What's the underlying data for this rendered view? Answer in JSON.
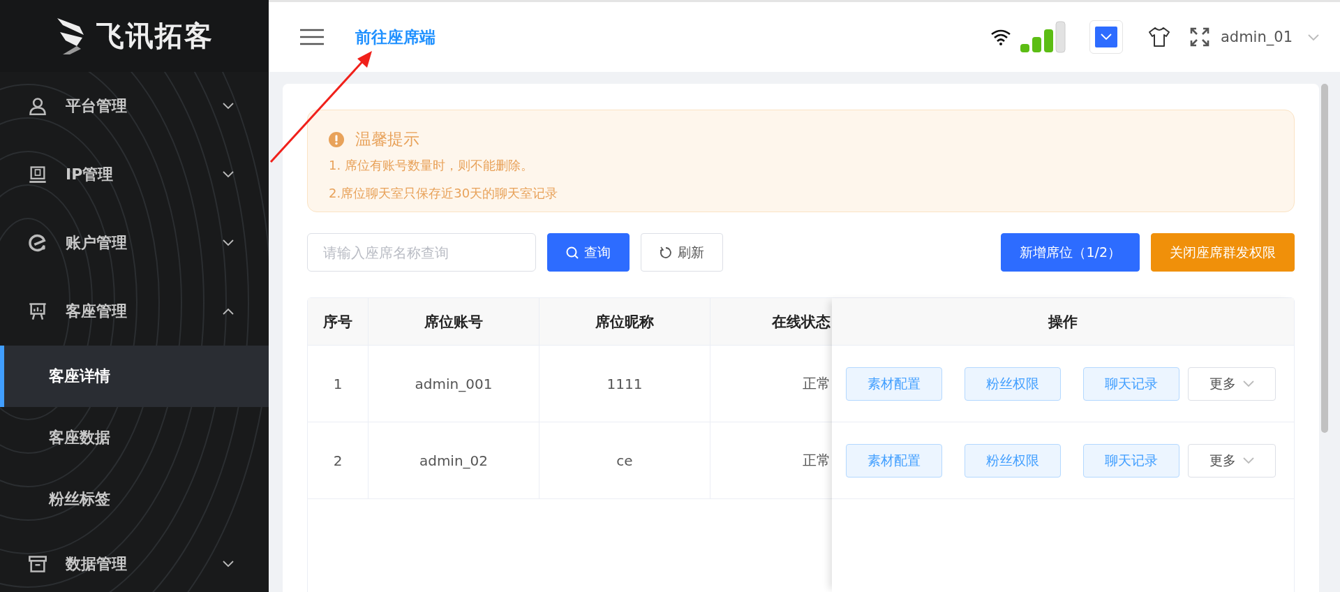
{
  "logo": {
    "text": "飞讯拓客"
  },
  "sidebar": {
    "items": [
      {
        "label": "平台管理",
        "expanded": false
      },
      {
        "label": "IP管理",
        "expanded": false
      },
      {
        "label": "账户管理",
        "expanded": false
      },
      {
        "label": "客座管理",
        "expanded": true,
        "children": [
          {
            "label": "客座详情",
            "selected": true
          },
          {
            "label": "客座数据",
            "selected": false
          },
          {
            "label": "粉丝标签",
            "selected": false
          }
        ]
      },
      {
        "label": "数据管理",
        "expanded": false
      }
    ]
  },
  "header": {
    "link": "前往座席端",
    "user": "admin_01"
  },
  "alert": {
    "title": "温馨提示",
    "lines": [
      "1. 席位有账号数量时，则不能删除。",
      "2.席位聊天室只保存近30天的聊天室记录"
    ]
  },
  "search": {
    "placeholder": "请输入座席名称查询"
  },
  "toolbar_left": [
    {
      "label": "查询",
      "kind": "primary"
    },
    {
      "label": "刷新",
      "kind": "default"
    }
  ],
  "toolbar_right": [
    {
      "label": "新增席位（1/2）",
      "kind": "primary"
    },
    {
      "label": "关闭座席群发权限",
      "kind": "warning"
    }
  ],
  "table": {
    "columns": [
      "序号",
      "席位账号",
      "席位昵称",
      "在线状态"
    ],
    "actions_column": "操作",
    "rows": [
      {
        "cells": [
          "1",
          "admin_001",
          "1111",
          "正常"
        ],
        "actions": [
          {
            "label": "素材配置",
            "kind": "plain"
          },
          {
            "label": "粉丝权限",
            "kind": "plain"
          },
          {
            "label": "聊天记录",
            "kind": "plain"
          },
          {
            "label": "更多",
            "kind": "dropdown"
          }
        ]
      },
      {
        "cells": [
          "2",
          "admin_02",
          "ce",
          "正常"
        ],
        "actions": [
          {
            "label": "素材配置",
            "kind": "plain"
          },
          {
            "label": "粉丝权限",
            "kind": "plain"
          },
          {
            "label": "聊天记录",
            "kind": "plain"
          },
          {
            "label": "更多",
            "kind": "dropdown"
          }
        ]
      }
    ]
  }
}
